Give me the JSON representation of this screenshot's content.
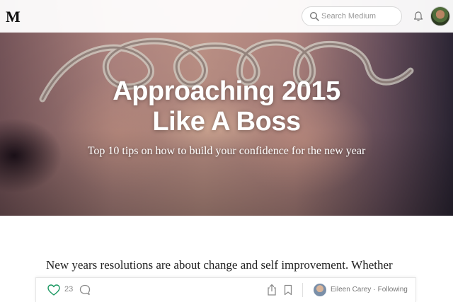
{
  "header": {
    "logo": "M",
    "search_placeholder": "Search Medium"
  },
  "hero": {
    "title_line1": "Approaching 2015",
    "title_line2": "Like A Boss",
    "subtitle": "Top 10 tips on how to build your confidence for the new year"
  },
  "article": {
    "first_line": "New years resolutions are about change and self improvement. Whether"
  },
  "action_bar": {
    "recommend_count": "23",
    "author_name": "Eileen Carey",
    "separator": "·",
    "follow_status": "Following"
  },
  "colors": {
    "accent_green": "#1c9963",
    "icon_gray": "#8a8a8a"
  }
}
